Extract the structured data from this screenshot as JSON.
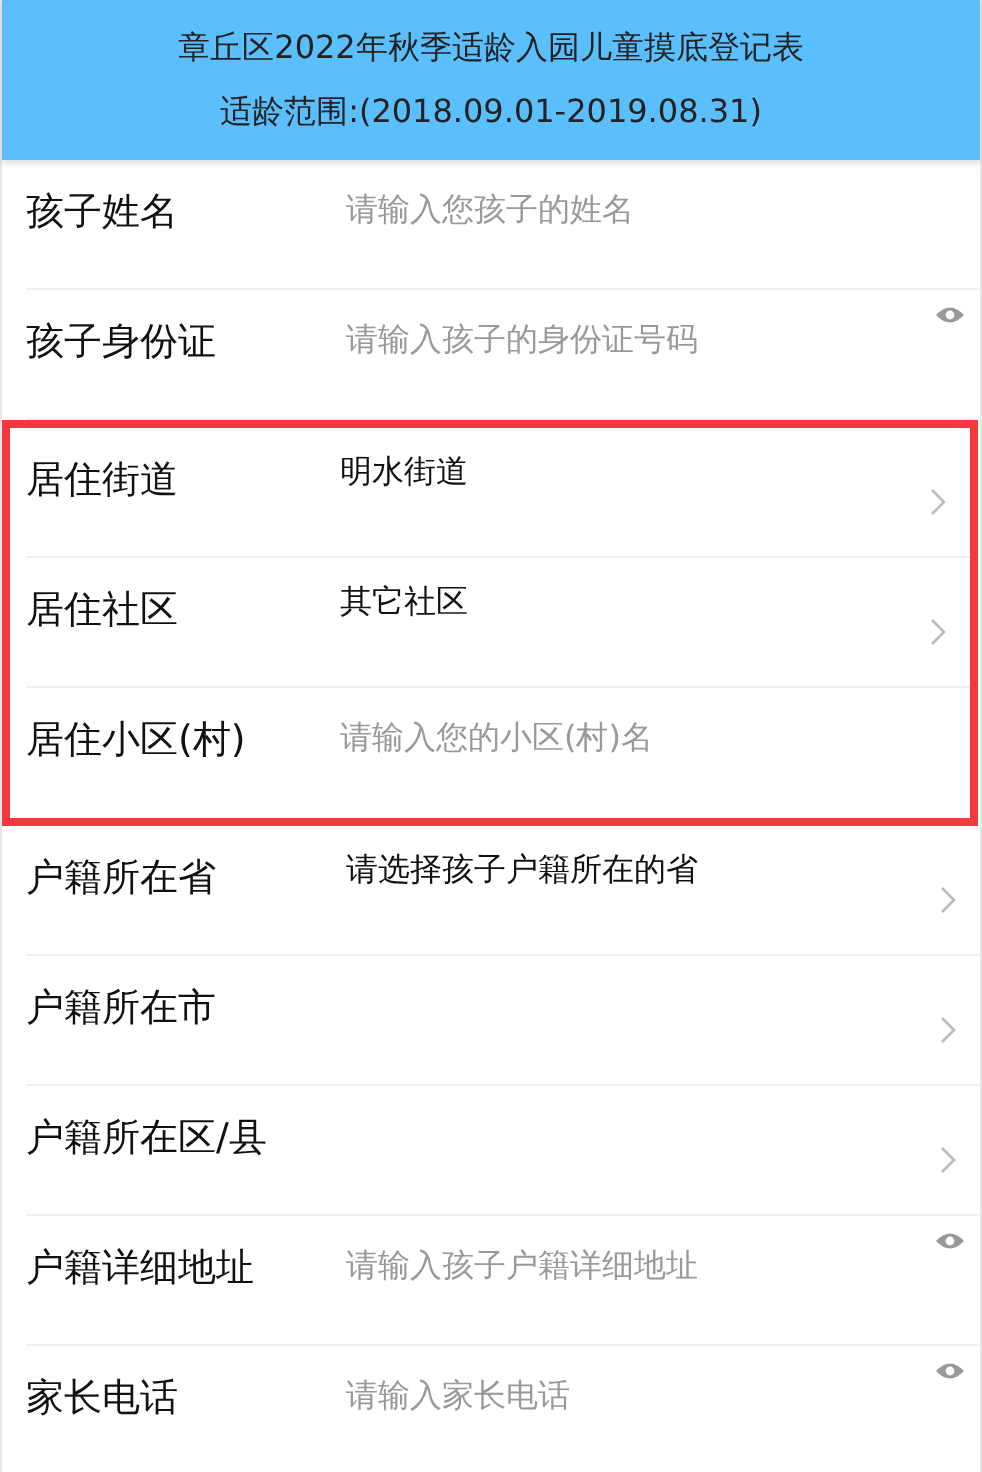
{
  "header": {
    "title": "章丘区2022年秋季适龄入园儿童摸底登记表",
    "subtitle": "适龄范围:(2018.09.01-2019.08.31)"
  },
  "groups": [
    {
      "highlighted": false,
      "rows": [
        {
          "kind": "input",
          "label": "孩子姓名",
          "placeholder": "请输入您孩子的姓名",
          "eye": false
        },
        {
          "kind": "input",
          "label": "孩子身份证",
          "placeholder": "请输入孩子的身份证号码",
          "eye": true
        }
      ]
    },
    {
      "highlighted": true,
      "rows": [
        {
          "kind": "select",
          "label": "居住街道",
          "value": "明水街道"
        },
        {
          "kind": "select",
          "label": "居住社区",
          "value": "其它社区"
        },
        {
          "kind": "input",
          "label": "居住小区(村)",
          "placeholder": "请输入您的小区(村)名",
          "eye": false
        }
      ]
    },
    {
      "highlighted": false,
      "rows": [
        {
          "kind": "select",
          "label": "户籍所在省",
          "value": "请选择孩子户籍所在的省"
        },
        {
          "kind": "select",
          "label": "户籍所在市"
        },
        {
          "kind": "select",
          "label": "户籍所在区/县"
        },
        {
          "kind": "input",
          "label": "户籍详细地址",
          "placeholder": "请输入孩子户籍详细地址",
          "eye": true
        },
        {
          "kind": "input",
          "label": "家长电话",
          "placeholder": "请输入家长电话",
          "eye": true
        }
      ]
    }
  ]
}
